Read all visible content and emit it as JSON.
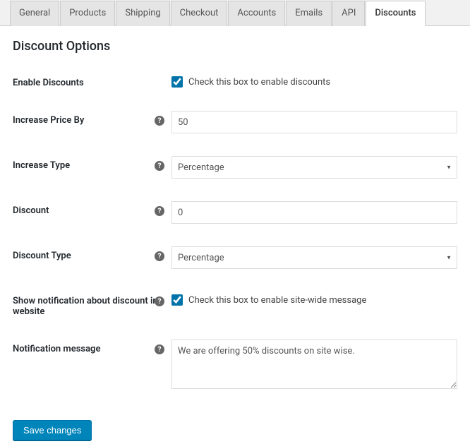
{
  "tabs": [
    {
      "label": "General"
    },
    {
      "label": "Products"
    },
    {
      "label": "Shipping"
    },
    {
      "label": "Checkout"
    },
    {
      "label": "Accounts"
    },
    {
      "label": "Emails"
    },
    {
      "label": "API"
    },
    {
      "label": "Discounts"
    }
  ],
  "active_tab": "Discounts",
  "heading": "Discount Options",
  "fields": {
    "enable_discounts": {
      "label": "Enable Discounts",
      "checkbox_label": "Check this box to enable discounts",
      "checked": true
    },
    "increase_price_by": {
      "label": "Increase Price By",
      "value": "50"
    },
    "increase_type": {
      "label": "Increase Type",
      "value": "Percentage"
    },
    "discount": {
      "label": "Discount",
      "value": "0"
    },
    "discount_type": {
      "label": "Discount Type",
      "value": "Percentage"
    },
    "show_notification": {
      "label": "Show notification about discount in website",
      "checkbox_label": "Check this box to enable site-wide message",
      "checked": true
    },
    "notification_message": {
      "label": "Notification message",
      "value": "We are offering 50% discounts on site wise."
    }
  },
  "save_button": "Save changes",
  "help_glyph": "?"
}
